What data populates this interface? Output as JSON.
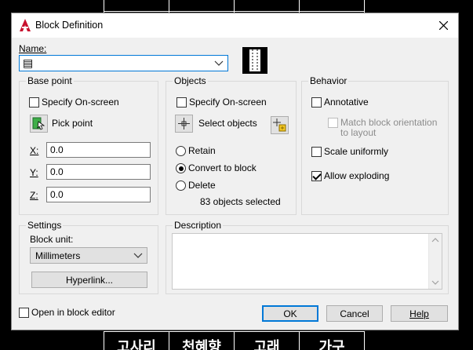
{
  "dialog": {
    "title": "Block Definition",
    "name_label": "Name:",
    "name_value": "▤"
  },
  "base_point": {
    "title": "Base point",
    "specify_onscreen": "Specify On-screen",
    "pick_point": "Pick point",
    "x_label": "X:",
    "x_value": "0.0",
    "y_label": "Y:",
    "y_value": "0.0",
    "z_label": "Z:",
    "z_value": "0.0"
  },
  "objects": {
    "title": "Objects",
    "specify_onscreen": "Specify On-screen",
    "select_objects": "Select objects",
    "retain": "Retain",
    "convert": "Convert to block",
    "delete": "Delete",
    "selected_count": "83 objects selected",
    "selected_option": "convert"
  },
  "behavior": {
    "title": "Behavior",
    "annotative": "Annotative",
    "match_orientation_1": "Match block orientation",
    "match_orientation_2": "to layout",
    "scale_uniformly": "Scale uniformly",
    "allow_exploding": "Allow exploding",
    "allow_exploding_checked": true
  },
  "settings": {
    "title": "Settings",
    "block_unit_label": "Block unit:",
    "block_unit_value": "Millimeters",
    "hyperlink": "Hyperlink..."
  },
  "description": {
    "title": "Description",
    "value": ""
  },
  "footer": {
    "open_in_editor": "Open in block editor",
    "ok": "OK",
    "cancel": "Cancel",
    "help": "Help"
  },
  "background": {
    "cells": [
      "고사리",
      "천혜향",
      "고래",
      "가구"
    ]
  },
  "colors": {
    "accent": "#0078d7",
    "background": "#000000",
    "dialog_bg": "#f0f0f0",
    "app_icon": "#c8102e"
  }
}
